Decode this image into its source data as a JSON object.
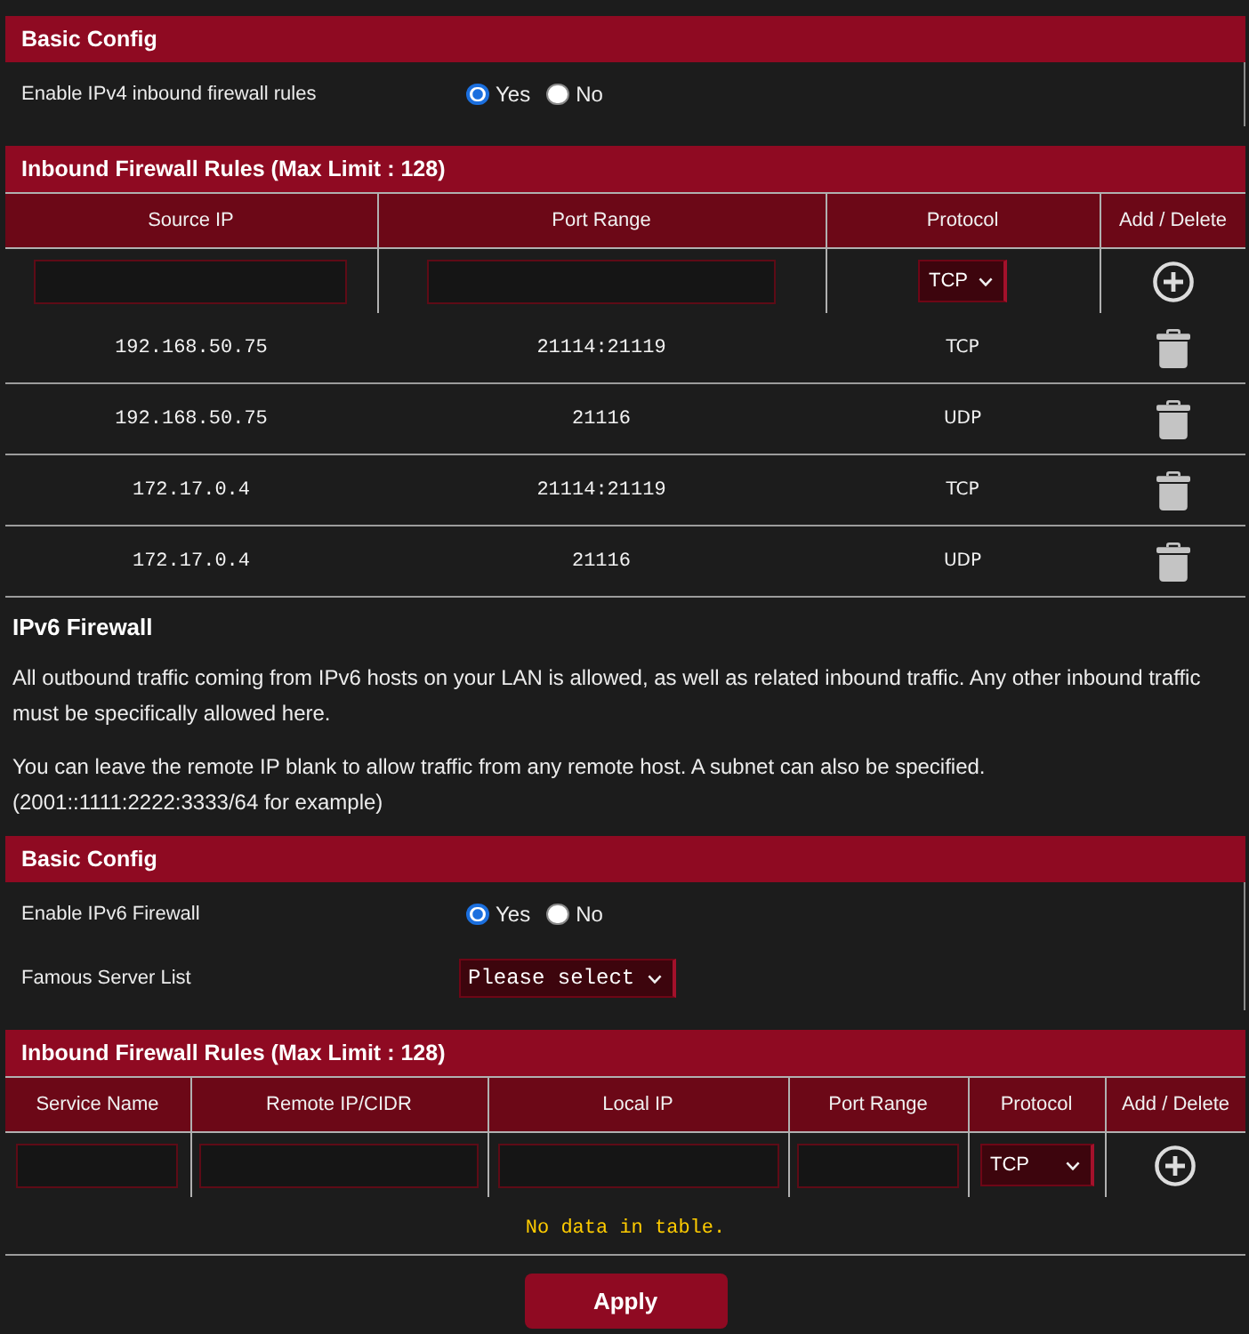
{
  "ipv4_basic_config": {
    "title": "Basic Config",
    "settings": [
      {
        "kind": "radio",
        "label": "Enable IPv4 inbound firewall rules",
        "options": [
          {
            "label": "Yes",
            "selected": true
          },
          {
            "label": "No",
            "selected": false
          }
        ]
      }
    ]
  },
  "ipv4_rules": {
    "title": "Inbound Firewall Rules (Max Limit : 128)",
    "columns": [
      "Source IP",
      "Port Range",
      "Protocol",
      "Add / Delete"
    ],
    "new_rule": [
      {
        "kind": "input"
      },
      {
        "kind": "input"
      },
      {
        "kind": "select",
        "value": "TCP"
      },
      {
        "kind": "add"
      }
    ],
    "rows": [
      {
        "source_ip": "192.168.50.75",
        "port_range": "21114:21119",
        "protocol": "TCP"
      },
      {
        "source_ip": "192.168.50.75",
        "port_range": "21116",
        "protocol": "UDP"
      },
      {
        "source_ip": "172.17.0.4",
        "port_range": "21114:21119",
        "protocol": "TCP"
      },
      {
        "source_ip": "172.17.0.4",
        "port_range": "21116",
        "protocol": "UDP"
      }
    ]
  },
  "ipv6_firewall": {
    "title": "IPv6 Firewall",
    "paragraphs": [
      "All outbound traffic coming from IPv6 hosts on your LAN is allowed, as well as related inbound traffic. Any other inbound traffic must be specifically allowed here.",
      "You can leave the remote IP blank to allow traffic from any remote host. A subnet can also be specified. (2001::1111:2222:3333/64 for example)"
    ]
  },
  "ipv6_basic_config": {
    "title": "Basic Config",
    "settings": [
      {
        "kind": "radio",
        "label": "Enable IPv6 Firewall",
        "options": [
          {
            "label": "Yes",
            "selected": true
          },
          {
            "label": "No",
            "selected": false
          }
        ]
      },
      {
        "kind": "select",
        "label": "Famous Server List",
        "value": "Please select"
      }
    ]
  },
  "ipv6_rules": {
    "title": "Inbound Firewall Rules (Max Limit : 128)",
    "columns": [
      "Service Name",
      "Remote IP/CIDR",
      "Local IP",
      "Port Range",
      "Protocol",
      "Add / Delete"
    ],
    "new_rule": [
      {
        "kind": "input"
      },
      {
        "kind": "input"
      },
      {
        "kind": "input"
      },
      {
        "kind": "input"
      },
      {
        "kind": "select",
        "value": "TCP"
      },
      {
        "kind": "add"
      }
    ],
    "empty_message": "No data in table."
  },
  "apply_button": {
    "label": "Apply"
  }
}
